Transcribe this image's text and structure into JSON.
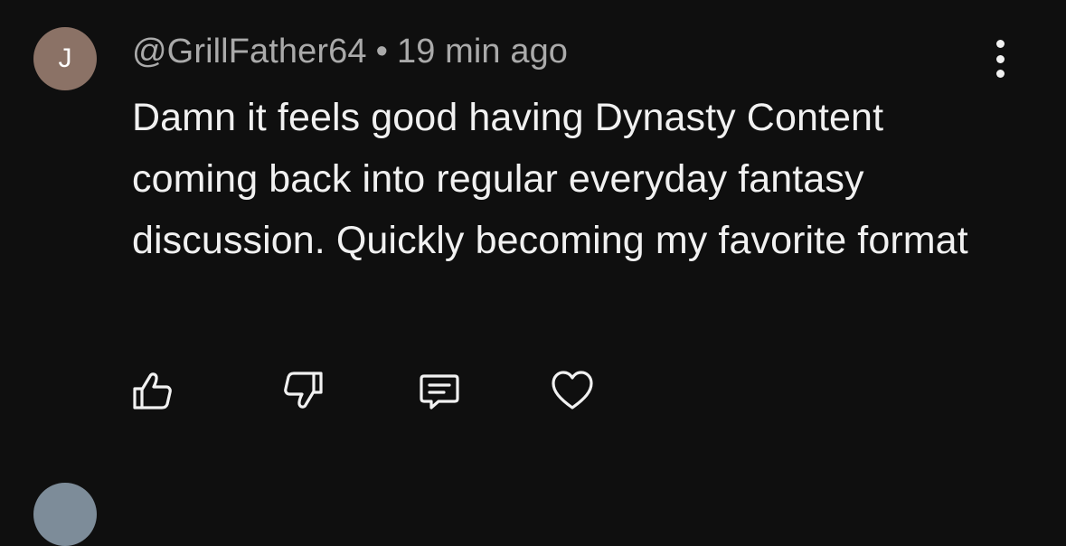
{
  "comment": {
    "avatar_letter": "J",
    "avatar_color": "#8b7266",
    "author": "@GrillFather64",
    "separator": "•",
    "time": "19 min ago",
    "text": "Damn it feels good having Dynasty Content coming back into regular everyday fantasy discussion. Quickly becoming my favorite format",
    "actions": {
      "like_icon": "thumbs-up-icon",
      "dislike_icon": "thumbs-down-icon",
      "reply_icon": "reply-icon",
      "heart_icon": "heart-icon",
      "more_icon": "more-vertical-icon"
    }
  },
  "next_comment": {
    "avatar_color": "#7d8c99"
  }
}
